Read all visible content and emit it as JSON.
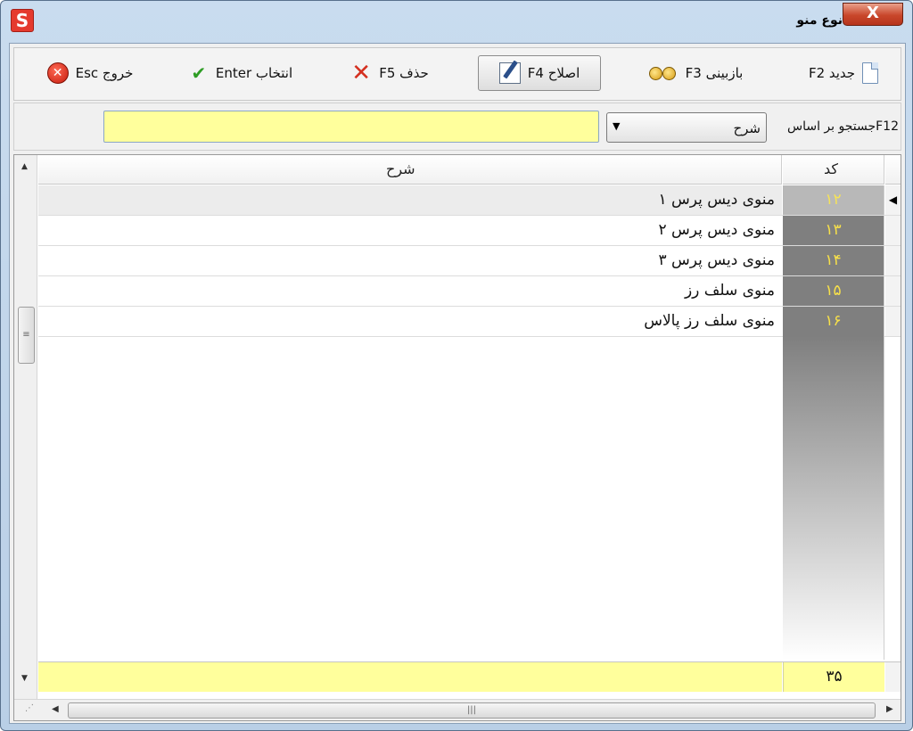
{
  "window": {
    "title": "نوع منو",
    "app_icon": "app-logo-icon",
    "close_label": "X"
  },
  "toolbar": {
    "new_label": "جدید F2",
    "view_label": "بازبینی F3",
    "edit_label": "اصلاح F4",
    "delete_label": "حذف F5",
    "select_label": "انتخاب Enter",
    "exit_label": "خروج Esc"
  },
  "search": {
    "label": "F12جستجو بر اساس",
    "field_selected": "شرح",
    "value": ""
  },
  "grid": {
    "columns": {
      "description": "شرح",
      "code": "کد"
    },
    "rows": [
      {
        "code": "۱۲",
        "description": "منوی دیس پرس ۱"
      },
      {
        "code": "۱۳",
        "description": "منوی دیس پرس ۲"
      },
      {
        "code": "۱۴",
        "description": "منوی دیس پرس ۳"
      },
      {
        "code": "۱۵",
        "description": "منوی سلف رز"
      },
      {
        "code": "۱۶",
        "description": "منوی سلف رز پالاس"
      }
    ],
    "selected_row_index": 0,
    "total": "۳۵"
  },
  "colors": {
    "search_bg": "#ffff9c",
    "code_text": "#f7e04a",
    "code_bg": "#7f7f7f"
  }
}
